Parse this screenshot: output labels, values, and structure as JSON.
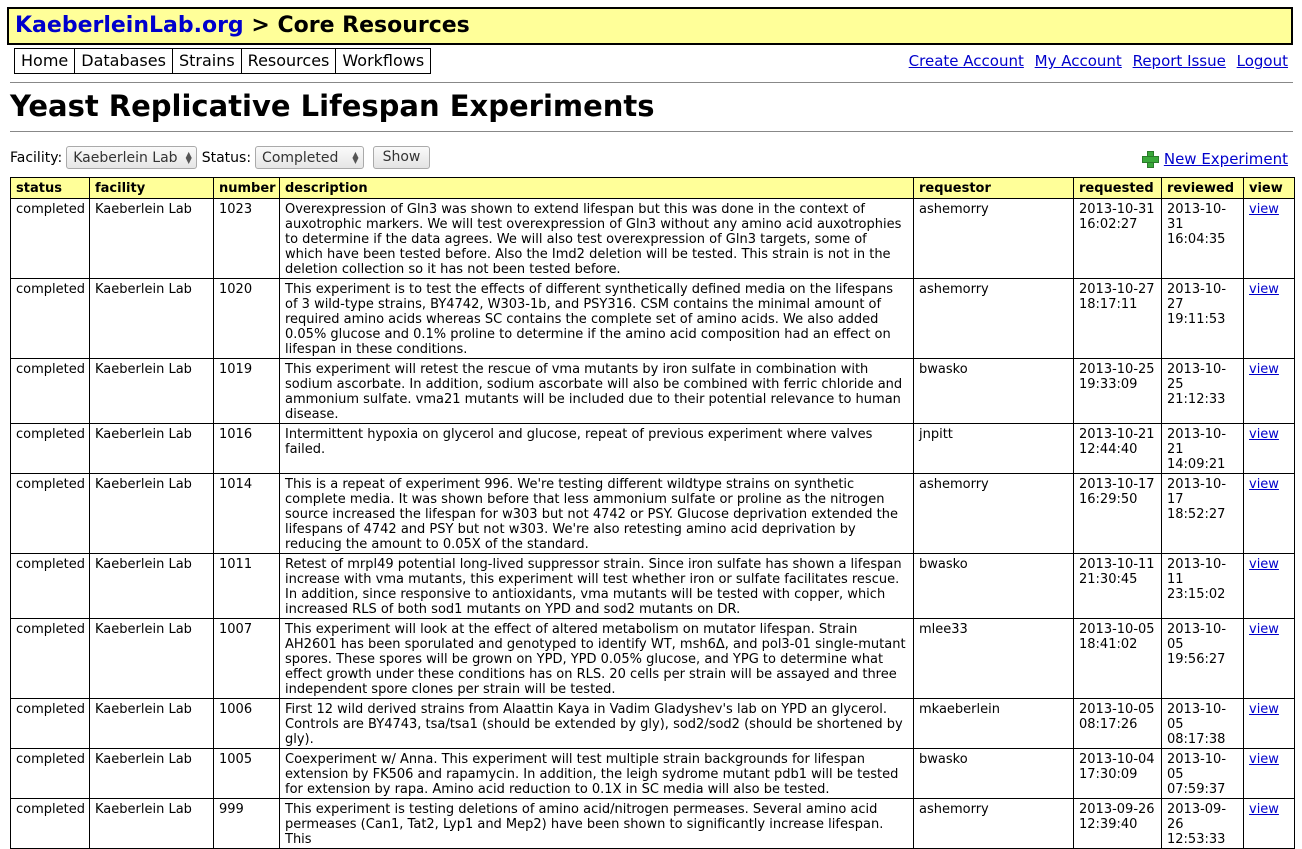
{
  "site": {
    "name": "KaeberleinLab.org",
    "separator": " > ",
    "section": "Core Resources"
  },
  "nav": [
    "Home",
    "Databases",
    "Strains",
    "Resources",
    "Workflows"
  ],
  "user_links": [
    "Create Account",
    "My Account",
    "Report Issue",
    "Logout"
  ],
  "page_title": "Yeast Replicative Lifespan Experiments",
  "filters": {
    "facility_label": "Facility:",
    "facility_value": "Kaeberlein Lab",
    "status_label": "Status:",
    "status_value": "Completed",
    "show_button": "Show"
  },
  "new_experiment": "New Experiment",
  "icons": {
    "new_experiment": "plus-icon",
    "select": "updown-arrow-icon"
  },
  "colors": {
    "banner_bg": "#ffff99",
    "header_bg": "#ffff99",
    "link": "#0000cc",
    "plus_icon": "#3aa83a"
  },
  "table": {
    "headers": [
      "status",
      "facility",
      "number",
      "description",
      "requestor",
      "requested",
      "reviewed",
      "view"
    ],
    "rows": [
      {
        "status": "completed",
        "facility": "Kaeberlein Lab",
        "number": "1023",
        "description": "Overexpression of Gln3 was shown to extend lifespan but this was done in the context of auxotrophic markers. We will test overexpression of Gln3 without any amino acid auxotrophies to determine if the data agrees. We will also test overexpression of Gln3 targets, some of which have been tested before. Also the Imd2 deletion will be tested. This strain is not in the deletion collection so it has not been tested before.",
        "requestor": "ashemorry",
        "requested": "2013-10-31 16:02:27",
        "reviewed": "2013-10-31 16:04:35",
        "view": "view"
      },
      {
        "status": "completed",
        "facility": "Kaeberlein Lab",
        "number": "1020",
        "description": "This experiment is to test the effects of different synthetically defined media on the lifespans of 3 wild-type strains, BY4742, W303-1b, and PSY316. CSM contains the minimal amount of required amino acids whereas SC contains the complete set of amino acids. We also added 0.05% glucose and 0.1% proline to determine if the amino acid composition had an effect on lifespan in these conditions.",
        "requestor": "ashemorry",
        "requested": "2013-10-27 18:17:11",
        "reviewed": "2013-10-27 19:11:53",
        "view": "view"
      },
      {
        "status": "completed",
        "facility": "Kaeberlein Lab",
        "number": "1019",
        "description": "This experiment will retest the rescue of vma mutants by iron sulfate in combination with sodium ascorbate. In addition, sodium ascorbate will also be combined with ferric chloride and ammonium sulfate. vma21 mutants will be included due to their potential relevance to human disease.",
        "requestor": "bwasko",
        "requested": "2013-10-25 19:33:09",
        "reviewed": "2013-10-25 21:12:33",
        "view": "view"
      },
      {
        "status": "completed",
        "facility": "Kaeberlein Lab",
        "number": "1016",
        "description": "Intermittent hypoxia on glycerol and glucose, repeat of previous experiment where valves failed.",
        "requestor": "jnpitt",
        "requested": "2013-10-21 12:44:40",
        "reviewed": "2013-10-21 14:09:21",
        "view": "view"
      },
      {
        "status": "completed",
        "facility": "Kaeberlein Lab",
        "number": "1014",
        "description": "This is a repeat of experiment 996. We're testing different wildtype strains on synthetic complete media. It was shown before that less ammonium sulfate or proline as the nitrogen source increased the lifespan for w303 but not 4742 or PSY. Glucose deprivation extended the lifespans of 4742 and PSY but not w303. We're also retesting amino acid deprivation by reducing the amount to 0.05X of the standard.",
        "requestor": "ashemorry",
        "requested": "2013-10-17 16:29:50",
        "reviewed": "2013-10-17 18:52:27",
        "view": "view"
      },
      {
        "status": "completed",
        "facility": "Kaeberlein Lab",
        "number": "1011",
        "description": "Retest of mrpl49 potential long-lived suppressor strain. Since iron sulfate has shown a lifespan increase with vma mutants, this experiment will test whether iron or sulfate facilitates rescue. In addition, since responsive to antioxidants, vma mutants will be tested with copper, which increased RLS of both sod1 mutants on YPD and sod2 mutants on DR.",
        "requestor": "bwasko",
        "requested": "2013-10-11 21:30:45",
        "reviewed": "2013-10-11 23:15:02",
        "view": "view"
      },
      {
        "status": "completed",
        "facility": "Kaeberlein Lab",
        "number": "1007",
        "description": "This experiment will look at the effect of altered metabolism on mutator lifespan. Strain AH2601 has been sporulated and genotyped to identify WT, msh6Δ, and pol3-01 single-mutant spores. These spores will be grown on YPD, YPD 0.05% glucose, and YPG to determine what effect growth under these conditions has on RLS. 20 cells per strain will be assayed and three independent spore clones per strain will be tested.",
        "requestor": "mlee33",
        "requested": "2013-10-05 18:41:02",
        "reviewed": "2013-10-05 19:56:27",
        "view": "view"
      },
      {
        "status": "completed",
        "facility": "Kaeberlein Lab",
        "number": "1006",
        "description": "First 12 wild derived strains from Alaattin Kaya in Vadim Gladyshev's lab on YPD an glycerol. Controls are BY4743, tsa/tsa1 (should be extended by gly), sod2/sod2 (should be shortened by gly).",
        "requestor": "mkaeberlein",
        "requested": "2013-10-05 08:17:26",
        "reviewed": "2013-10-05 08:17:38",
        "view": "view"
      },
      {
        "status": "completed",
        "facility": "Kaeberlein Lab",
        "number": "1005",
        "description": "Coexperiment w/ Anna. This experiment will test multiple strain backgrounds for lifespan extension by FK506 and rapamycin. In addition, the leigh sydrome mutant pdb1 will be tested for extension by rapa. Amino acid reduction to 0.1X in SC media will also be tested.",
        "requestor": "bwasko",
        "requested": "2013-10-04 17:30:09",
        "reviewed": "2013-10-05 07:59:37",
        "view": "view"
      },
      {
        "status": "completed",
        "facility": "Kaeberlein Lab",
        "number": "999",
        "description": "This experiment is testing deletions of amino acid/nitrogen permeases. Several amino acid permeases (Can1, Tat2, Lyp1 and Mep2) have been shown to significantly increase lifespan. This",
        "requestor": "ashemorry",
        "requested": "2013-09-26 12:39:40",
        "reviewed": "2013-09-26 12:53:33",
        "view": "view"
      }
    ]
  }
}
